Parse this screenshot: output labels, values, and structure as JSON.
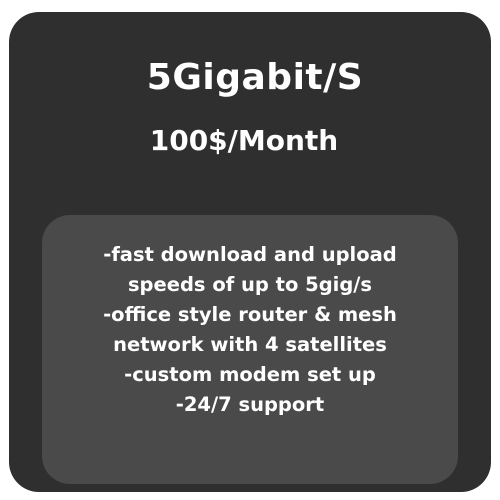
{
  "plan": {
    "speed": "5Gigabit/S",
    "price": "100$/Month",
    "features": [
      "-fast download and upload",
      "speeds of up to 5gig/s",
      "-office style router & mesh",
      "network with 4 satellites",
      "-custom modem set up",
      "-24/7 support"
    ]
  },
  "colors": {
    "card_background": "#2f2f2f",
    "features_background": "#4a4a4a",
    "text": "#ffffff"
  }
}
